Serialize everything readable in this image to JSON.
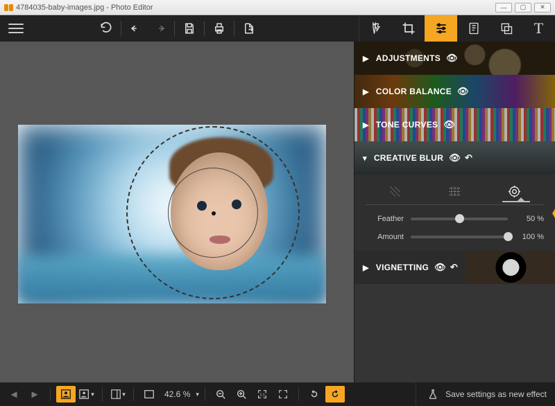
{
  "window": {
    "title": "4784035-baby-images.jpg - Photo Editor"
  },
  "toolbar": {
    "menu": "menu",
    "undo_dropdown": "undo-history",
    "undo": "undo",
    "redo": "redo",
    "save": "save",
    "print": "print",
    "export": "export"
  },
  "top_tabs": [
    {
      "name": "effects",
      "label": "Effects"
    },
    {
      "name": "crop",
      "label": "Crop"
    },
    {
      "name": "adjust",
      "label": "Adjust"
    },
    {
      "name": "presets",
      "label": "Presets"
    },
    {
      "name": "overlay",
      "label": "Overlay"
    },
    {
      "name": "text",
      "label": "Text"
    }
  ],
  "top_tabs_active": "adjust",
  "panels": {
    "adjustments": {
      "label": "ADJUSTMENTS",
      "expanded": false,
      "visible": true
    },
    "color_balance": {
      "label": "COLOR BALANCE",
      "expanded": false,
      "visible": true
    },
    "tone_curves": {
      "label": "TONE CURVES",
      "expanded": false,
      "visible": true
    },
    "creative_blur": {
      "label": "CREATIVE BLUR",
      "expanded": true,
      "visible": true,
      "reset": true,
      "mode": "radial",
      "modes": [
        "linear",
        "grid",
        "radial"
      ],
      "feather": {
        "label": "Feather",
        "value": 50,
        "display": "50 %"
      },
      "amount": {
        "label": "Amount",
        "value": 100,
        "display": "100 %"
      }
    },
    "vignetting": {
      "label": "VIGNETTING",
      "expanded": false,
      "visible": true,
      "reset": true
    }
  },
  "canvas": {
    "filename": "4784035-baby-images.jpg",
    "selection_shape": "radial"
  },
  "statusbar": {
    "zoom": {
      "value": 42.6,
      "display": "42.6 %"
    },
    "save_effect_label": "Save settings as new effect"
  }
}
